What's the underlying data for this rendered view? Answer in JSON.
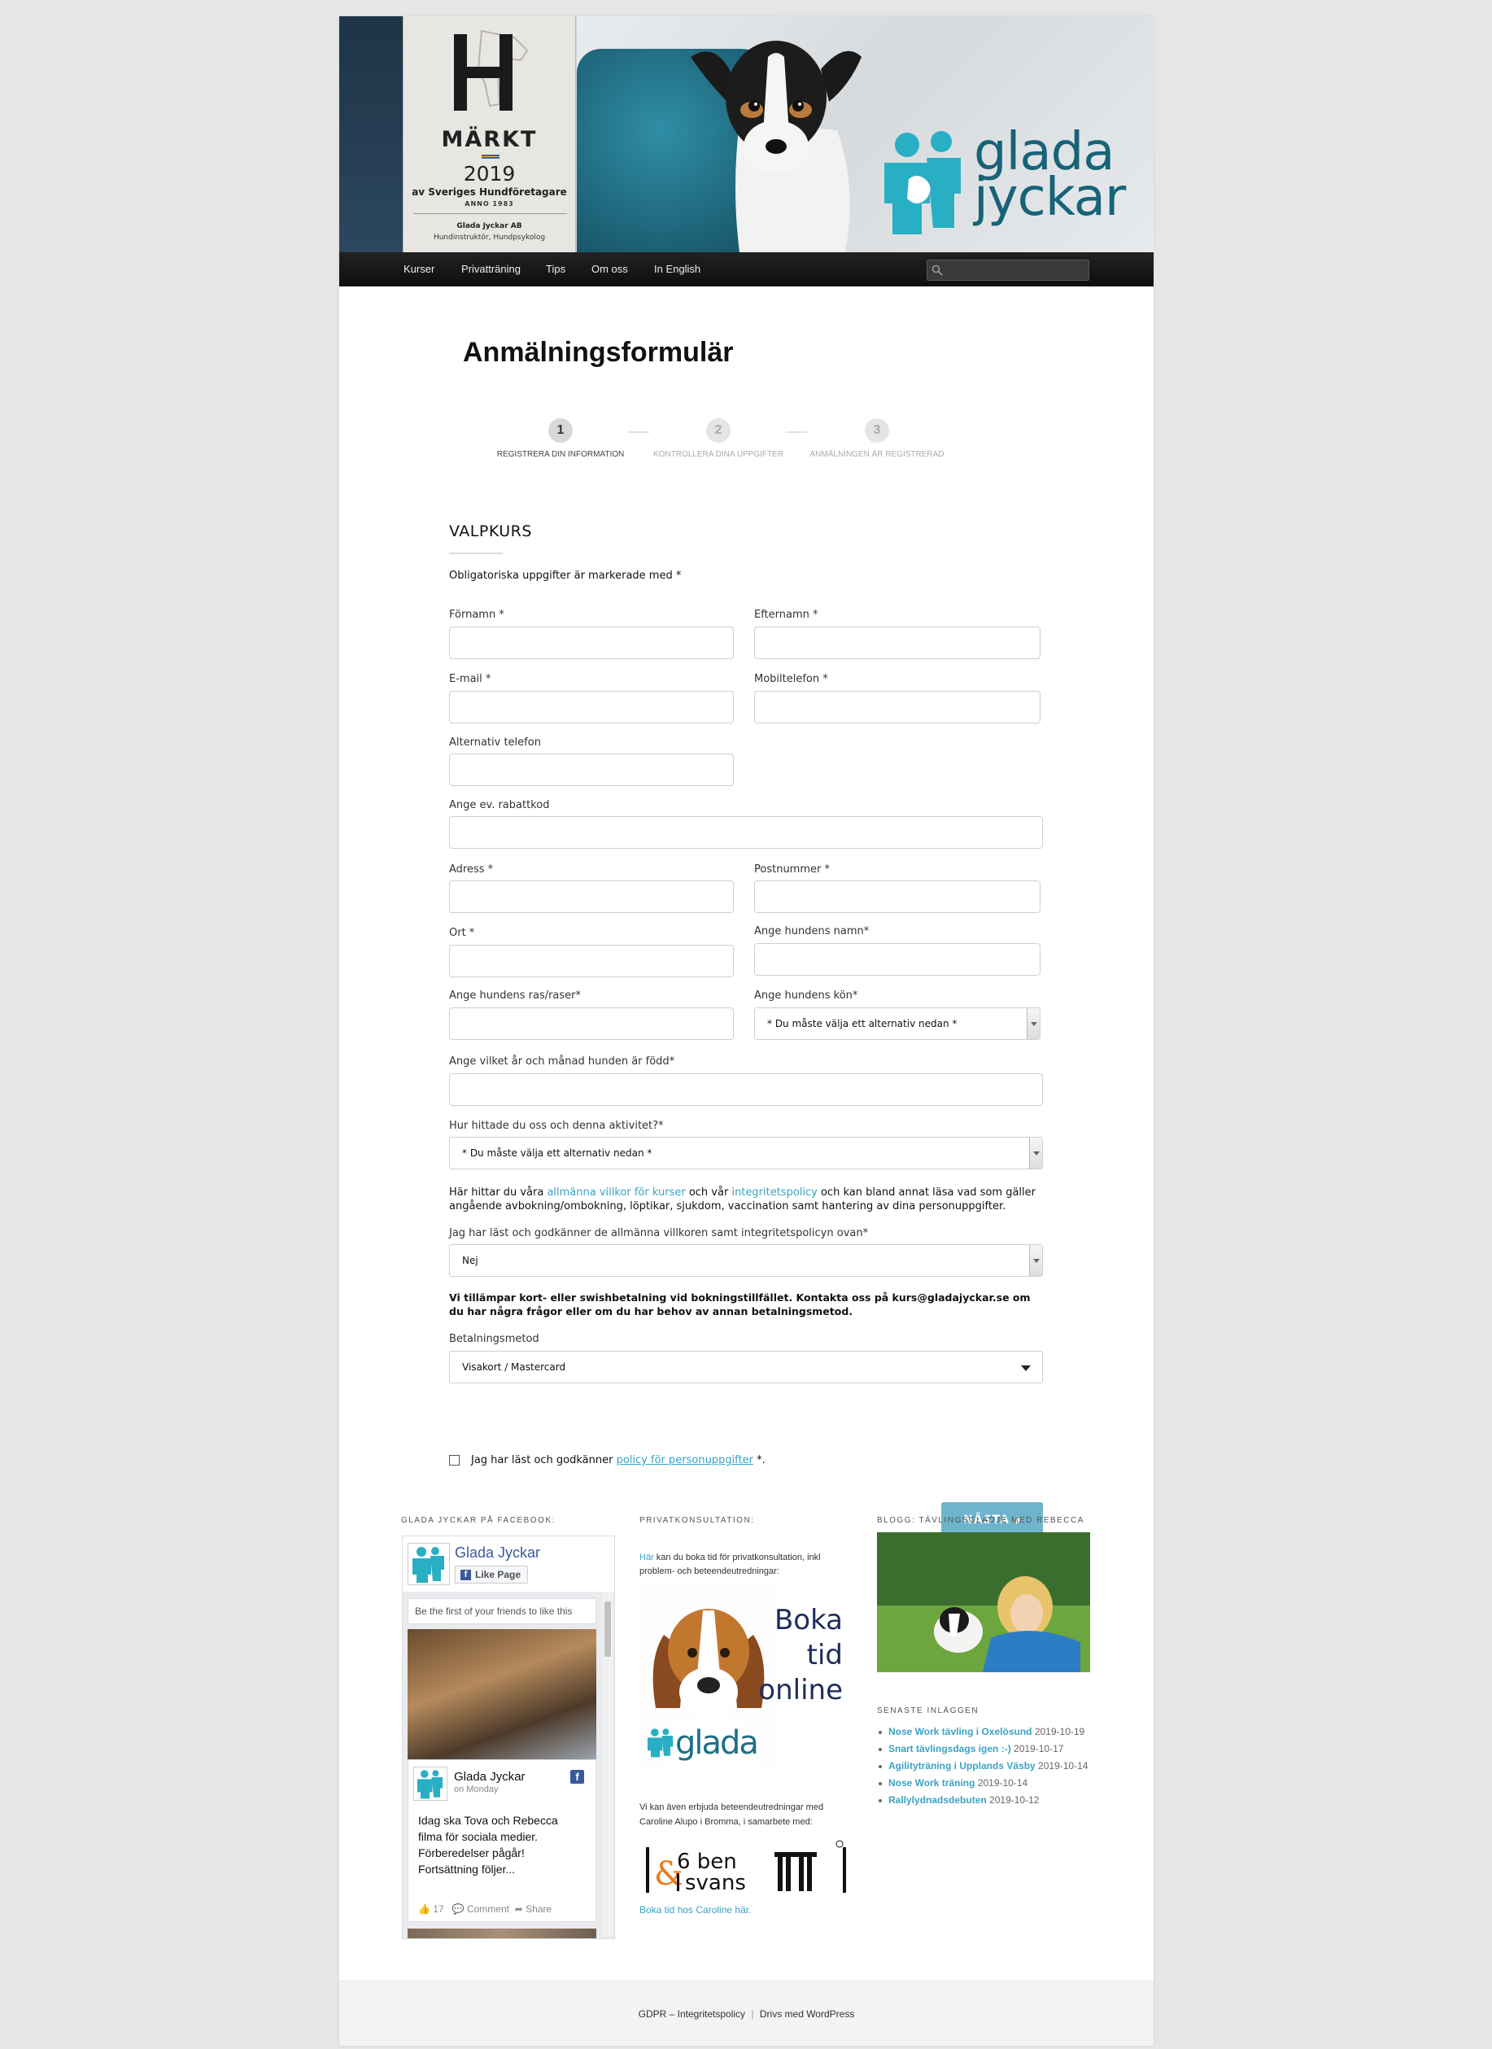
{
  "banner": {
    "badge_markt": "MÄRKT",
    "badge_year": "2019",
    "badge_sub": "av Sveriges Hundföretagare",
    "badge_anno": "ANNO 1983",
    "badge_company": "Glada Jyckar AB",
    "badge_role": "Hundinstruktör, Hundpsykolog",
    "logo_line1": "glada",
    "logo_line2": "jyckar",
    "brand_color": "#176378"
  },
  "nav": {
    "items": [
      "Kurser",
      "Privatträning",
      "Tips",
      "Om oss",
      "In English"
    ],
    "search_placeholder": "Sök"
  },
  "page": {
    "title": "Anmälningsformulär"
  },
  "steps": [
    {
      "number": "1",
      "label": "REGISTRERA DIN INFORMATION"
    },
    {
      "number": "2",
      "label": "KONTROLLERA DINA UPPGIFTER"
    },
    {
      "number": "3",
      "label": "ANMÄLNINGEN ÄR REGISTRERAD"
    }
  ],
  "form": {
    "section_title": "VALPKURS",
    "required_note": "Obligatoriska uppgifter är markerade med *",
    "labels": {
      "first_name": "Förnamn *",
      "last_name": "Efternamn *",
      "email": "E-mail *",
      "mobile": "Mobiltelefon *",
      "alt_phone": "Alternativ telefon",
      "discount": "Ange ev. rabattkod",
      "address": "Adress *",
      "postcode": "Postnummer *",
      "city": "Ort *",
      "dog_name": "Ange hundens namn*",
      "dog_breed": "Ange hundens ras/raser*",
      "dog_sex": "Ange hundens kön*",
      "dog_born": "Ange vilket år och månad hunden är född*",
      "found_us": "Hur hittade du oss och denna aktivitet?*",
      "accept_terms": "Jag har läst och godkänner de allmänna villkoren samt integritetspolicyn ovan*",
      "payment": "Betalningsmetod"
    },
    "dog_sex_value": "* Du måste välja ett alternativ nedan *",
    "found_us_value": "* Du måste välja ett alternativ nedan *",
    "terms_text_1": "Här hittar du våra ",
    "terms_link_1": "allmänna villkor för kurser",
    "terms_text_2": " och vår ",
    "terms_link_2": "integritetspolicy",
    "terms_text_3": " och kan bland annat läsa vad som gäller angående avbokning/ombokning, löptikar, sjukdom, vaccination samt hantering av dina personuppgifter.",
    "accept_terms_value": "Nej",
    "payment_info": "Vi tillämpar kort- eller swishbetalning vid bokningstillfället. Kontakta oss på kurs@gladajyckar.se om du har några frågor eller om du har behov av annan betalningsmetod.",
    "payment_value": "Visakort / Mastercard",
    "consent_text": "Jag har läst och godkänner ",
    "consent_link": "policy för personuppgifter",
    "consent_suffix": " *.",
    "next_label": "NÄSTA"
  },
  "footer_widgets": {
    "facebook": {
      "title": "GLADA JYCKAR PÅ FACEBOOK:",
      "page_name": "Glada Jyckar",
      "like_label": "Like Page",
      "friends_text": "Be the first of your friends to like this",
      "post_author": "Glada Jyckar",
      "post_time": "on Monday",
      "post_text": "Idag ska Tova och Rebecca filma för sociala medier. Förberedelser pågår! Fortsättning följer...",
      "likes": "17",
      "comment_label": "Comment",
      "share_label": "Share"
    },
    "privatkonsultation": {
      "title": "PRIVATKONSULTATION:",
      "link_word": "Här",
      "text": " kan du boka tid för privatkonsultation, inkl problem- och beteendeutredningar:",
      "ad_line1": "Boka",
      "ad_line2": "tid",
      "ad_line3": "online",
      "ad_brand": "glada jyckar",
      "text2": "Vi kan även erbjuda beteendeutredningar med Caroline Alupo i Bromma, i samarbete med:",
      "partner_line1": "6 ben",
      "partner_line2": "svans",
      "partner_link": "Boka tid hos Caroline här."
    },
    "blog": {
      "title": "BLOGG: TÄVLINGSGLÄDJE MED REBECCA",
      "recent_title": "SENASTE INLÄGGEN",
      "posts": [
        {
          "title": "Nose Work tävling i Oxelösund",
          "date": "2019-10-19"
        },
        {
          "title": "Snart tävlingsdags igen :-)",
          "date": "2019-10-17"
        },
        {
          "title": "Agilityträning i Upplands Väsby",
          "date": "2019-10-14"
        },
        {
          "title": "Nose Work träning",
          "date": "2019-10-14"
        },
        {
          "title": "Rallylydnadsdebuten",
          "date": "2019-10-12"
        }
      ]
    }
  },
  "site_footer": {
    "gdpr_link": "GDPR – Integritetspolicy",
    "separator": "|",
    "wp_link": "Drivs med WordPress"
  }
}
